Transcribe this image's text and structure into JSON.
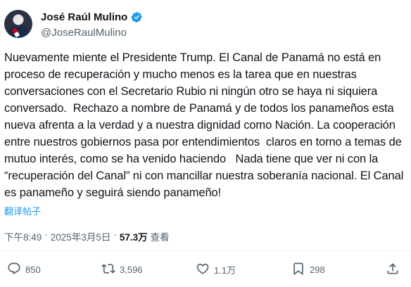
{
  "user": {
    "name": "José Raúl Mulino",
    "handle": "@JoseRaulMulino"
  },
  "tweet": {
    "text": "Nuevamente miente el Presidente Trump. El Canal de Panamá no está en proceso de recuperación y mucho menos es la tarea que en nuestras conversaciones con el Secretario Rubio ni ningún otro se haya ni siquiera conversado.  Rechazo a nombre de Panamá y de todos los panameños esta nueva afrenta a la verdad y a nuestra dignidad como Nación. La cooperación entre nuestros gobiernos pasa por entendimientos  claros en torno a temas de mutuo interés, como se ha venido haciendo   Nada tiene que ver ni con la “recuperación del Canal” ni con mancillar nuestra soberanía nacional. El Canal es panameño y seguirá siendo panameño!",
    "translate_label": "翻译帖子"
  },
  "meta": {
    "time": "下午8:49",
    "separator": "·",
    "date": "2025年3月5日",
    "separator2": "·",
    "views_count": "57.3万",
    "views_label": "查看"
  },
  "actions": {
    "replies": "850",
    "reposts": "3,596",
    "likes": "1.1万",
    "bookmarks": "298"
  },
  "colors": {
    "text": "#0f1419",
    "secondary": "#536471",
    "link": "#1d9bf0",
    "verified": "#1d9bf0"
  },
  "icons": [
    "verified-badge-icon",
    "reply-icon",
    "repost-icon",
    "like-icon",
    "bookmark-icon",
    "share-icon"
  ]
}
